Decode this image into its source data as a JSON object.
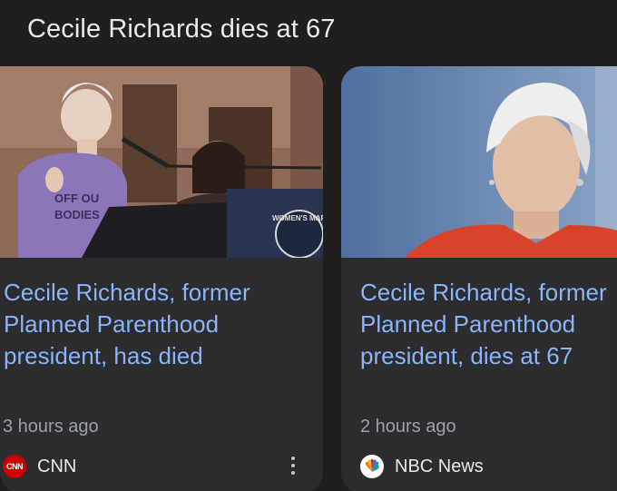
{
  "section": {
    "title": "Cecile Richards dies at 67"
  },
  "cards": [
    {
      "headline": "Cecile Richards, former\nPlanned Parenthood\npresident, has died",
      "time": "3 hours ago",
      "source": "CNN",
      "logo_text": "CNN",
      "image_sign_text": "OFF OUR BODIES",
      "image_banner_text": "WOMEN'S MARCH"
    },
    {
      "headline_lines": [
        "Cecile Richards, former",
        "Planned Parenthood",
        "president, dies at 67"
      ],
      "time": "2 hours ago",
      "source": "NBC News"
    }
  ],
  "colors": {
    "background": "#1f1f1f",
    "card": "#2c2c2e",
    "headline": "#8ab4f8",
    "meta": "#9aa0a6",
    "cnn_red": "#cc0000"
  },
  "icons": [
    "cnn-logo-icon",
    "nbc-peacock-icon",
    "more-vert-icon"
  ]
}
